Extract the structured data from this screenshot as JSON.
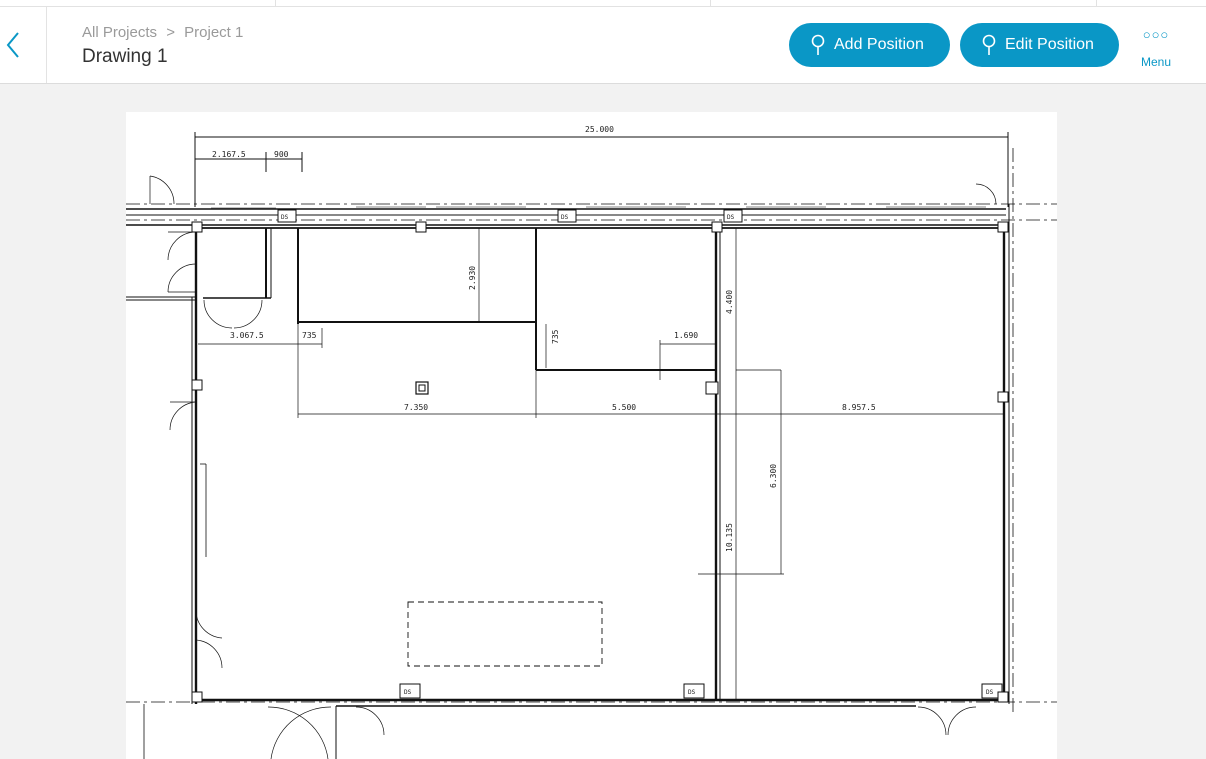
{
  "header": {
    "breadcrumb": [
      "All Projects",
      ">",
      "Project 1"
    ],
    "title": "Drawing 1",
    "add_position_label": "Add Position",
    "edit_position_label": "Edit Position",
    "menu_label": "Menu",
    "accent_color": "#0a97c6"
  },
  "drawing": {
    "dimensions": {
      "overall_width": "25.000",
      "d_2167": "2.167.5",
      "d_900": "900",
      "d_2930": "2.930",
      "d_4400": "4.400",
      "d_735_a": "735",
      "d_735_b": "735",
      "d_3067": "3.067.5",
      "d_1690": "1.690",
      "d_7350": "7.350",
      "d_5500": "5.500",
      "d_8957": "8.957.5",
      "d_6300": "6.300",
      "d_10135": "10.135"
    },
    "column_tag": "DS"
  }
}
